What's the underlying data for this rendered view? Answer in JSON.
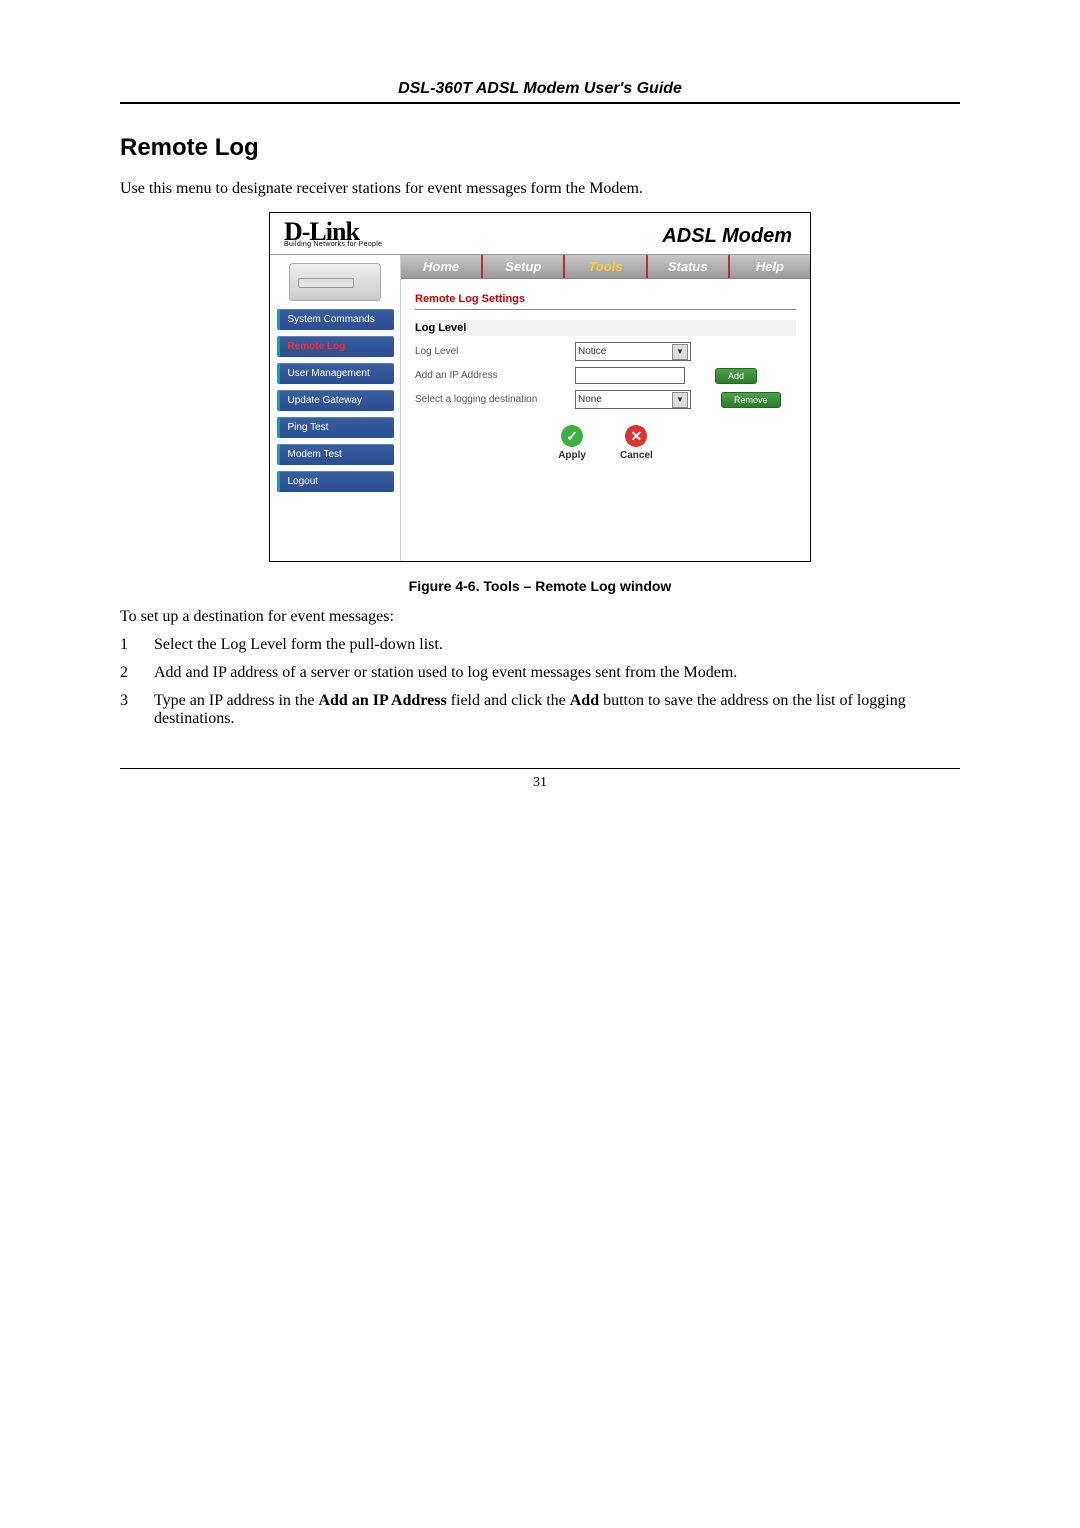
{
  "header_title": "DSL-360T ADSL Modem User's Guide",
  "section_heading": "Remote Log",
  "intro": "Use this menu to designate receiver stations for event messages form the Modem.",
  "screenshot": {
    "logo_brand": "D-Link",
    "logo_tag": "Building Networks for People",
    "product_title": "ADSL Modem",
    "tabs": [
      "Home",
      "Setup",
      "Tools",
      "Status",
      "Help"
    ],
    "active_tab": "Tools",
    "sidebar": [
      "System Commands",
      "Remote Log",
      "User Management",
      "Update Gateway",
      "Ping Test",
      "Modem Test",
      "Logout"
    ],
    "active_sidebar": "Remote Log",
    "panel_title": "Remote Log Settings",
    "subheader": "Log Level",
    "fields": {
      "log_level_label": "Log Level",
      "log_level_value": "Notice",
      "add_ip_label": "Add an IP Address",
      "add_button": "Add",
      "dest_label": "Select a logging destination",
      "dest_value": "None",
      "remove_button": "Remove"
    },
    "actions": {
      "apply": "Apply",
      "cancel": "Cancel"
    }
  },
  "figure_caption": "Figure 4-6. Tools – Remote Log window",
  "lead": "To set up a destination for event messages:",
  "steps": [
    {
      "n": "1",
      "text": "Select the Log Level form the pull-down list."
    },
    {
      "n": "2",
      "text": "Add and IP address of a server or station used to log event messages sent from the Modem."
    },
    {
      "n": "3",
      "html": "Type an IP address in the <b>Add an IP Address</b> field and click the <b>Add</b> button to save the address on the list of logging destinations."
    }
  ],
  "page_number": "31"
}
